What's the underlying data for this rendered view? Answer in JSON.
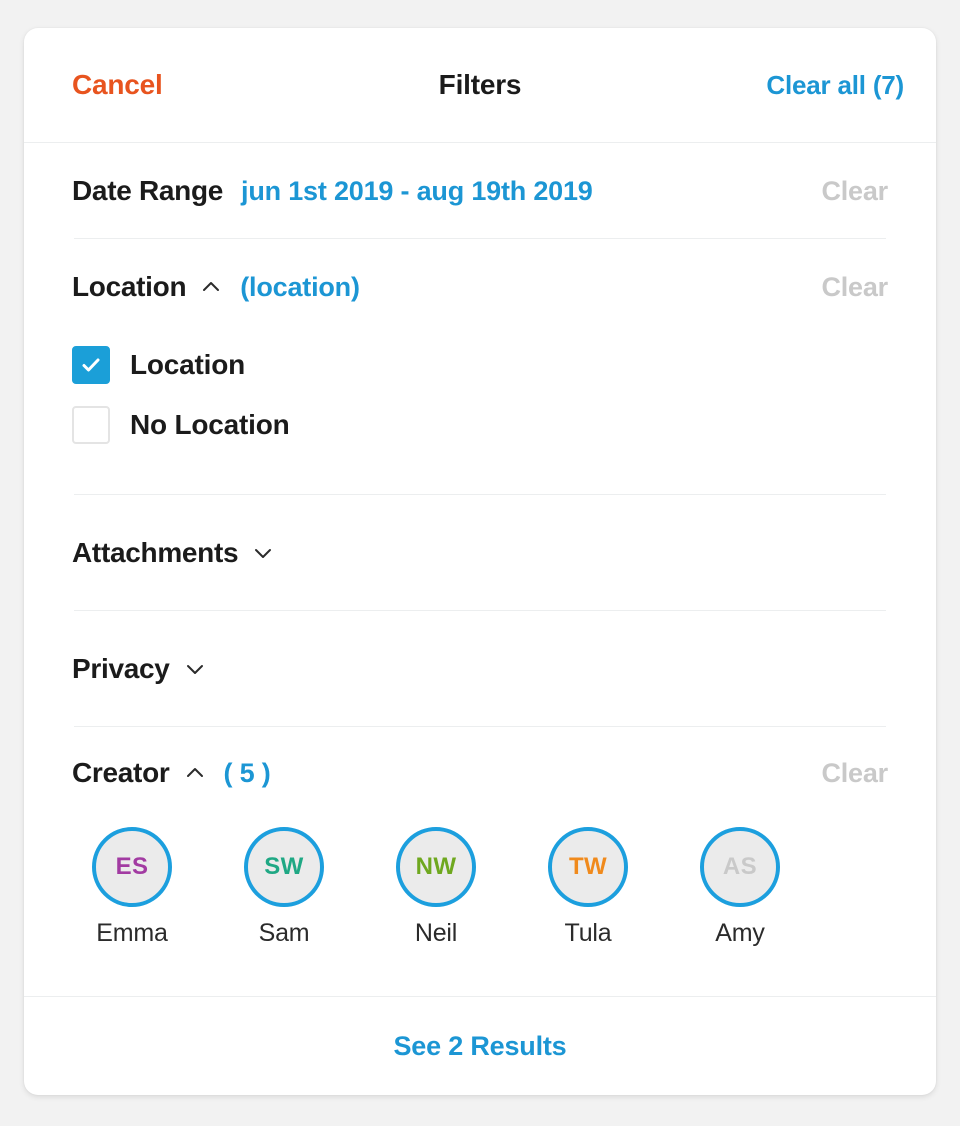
{
  "header": {
    "cancel_label": "Cancel",
    "title": "Filters",
    "clear_all_label": "Clear all (7)"
  },
  "sections": {
    "date_range": {
      "title": "Date Range",
      "value": "jun 1st 2019 - aug 19th 2019",
      "clear_label": "Clear"
    },
    "location": {
      "title": "Location",
      "value": "(location)",
      "clear_label": "Clear",
      "chevron": "chevron-up-icon",
      "options": [
        {
          "label": "Location",
          "checked": true
        },
        {
          "label": "No Location",
          "checked": false
        }
      ]
    },
    "attachments": {
      "title": "Attachments",
      "chevron": "chevron-down-icon"
    },
    "privacy": {
      "title": "Privacy",
      "chevron": "chevron-down-icon"
    },
    "creator": {
      "title": "Creator",
      "value": "( 5 )",
      "clear_label": "Clear",
      "chevron": "chevron-up-icon",
      "people": [
        {
          "initials": "ES",
          "name": "Emma",
          "color": "#a23ba2",
          "selected": true
        },
        {
          "initials": "SW",
          "name": "Sam",
          "color": "#1fa884",
          "selected": true
        },
        {
          "initials": "NW",
          "name": "Neil",
          "color": "#6fa81f",
          "selected": true
        },
        {
          "initials": "TW",
          "name": "Tula",
          "color": "#f08a1c",
          "selected": true
        },
        {
          "initials": "AS",
          "name": "Amy",
          "color": "#c9c9c9",
          "selected": true
        }
      ]
    }
  },
  "footer": {
    "see_results_label": "See 2 Results"
  },
  "colors": {
    "accent_blue": "#1c96d4",
    "checkbox_blue": "#1b9fd8",
    "cancel_orange": "#e8541f",
    "clear_gray": "#c9c9c9",
    "avatar_ring": "#1c9fde",
    "avatar_fill": "#ebebeb"
  }
}
